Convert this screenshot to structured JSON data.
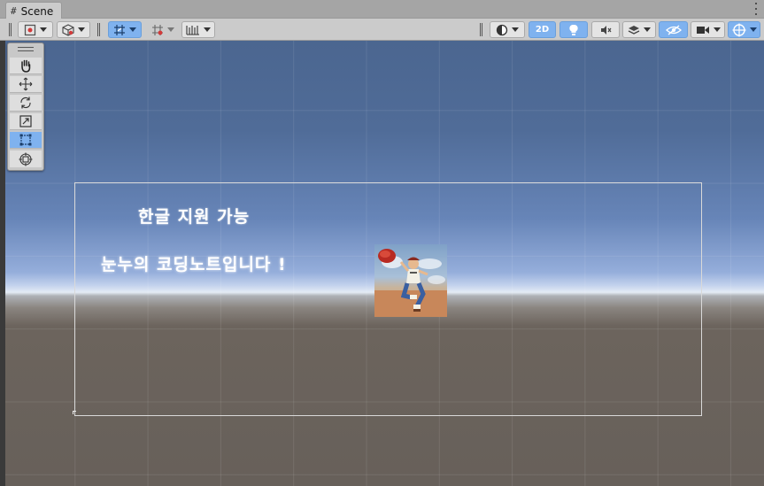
{
  "window": {
    "tab_label": "Scene"
  },
  "toolbar": {
    "left": [
      {
        "name": "draw-mode-dropdown",
        "icon": "draw-mode-icon"
      },
      {
        "name": "shading-dropdown",
        "icon": "cube-icon"
      },
      {
        "name": "grid-snap-toggle",
        "icon": "grid-snap-icon",
        "active": true
      },
      {
        "name": "increment-snap-toggle",
        "icon": "increment-snap-icon"
      },
      {
        "name": "gizmo-dropdown",
        "icon": "ruler-icon"
      }
    ],
    "right": {
      "mode_2d_label": "2D"
    }
  },
  "tools": [
    {
      "name": "hand-tool",
      "icon": "hand-icon"
    },
    {
      "name": "move-tool",
      "icon": "move-arrows-icon"
    },
    {
      "name": "rotate-tool",
      "icon": "rotate-icon"
    },
    {
      "name": "scale-tool",
      "icon": "scale-icon"
    },
    {
      "name": "rect-tool",
      "icon": "rect-icon",
      "active": true
    },
    {
      "name": "transform-tool",
      "icon": "transform-icon"
    }
  ],
  "scene": {
    "text_line_1": "한글 지원 가능",
    "text_line_2": "눈누의 코딩노트입니다 !"
  },
  "colors": {
    "accent": "#7fb2ef",
    "toolbar_bg": "#cbcbcb",
    "sky_top": "#4b6690",
    "ground": "#67605a"
  }
}
